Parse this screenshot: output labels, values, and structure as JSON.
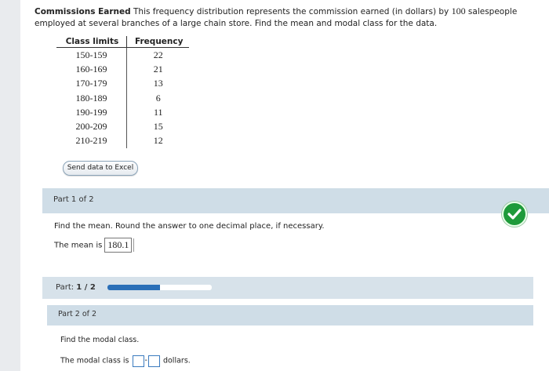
{
  "problem": {
    "title": "Commissions Earned",
    "text1": " This frequency distribution represents the commission earned (in dollars) by ",
    "count": "100",
    "text2": " salespeople employed at several branches of a large chain store. Find the mean and modal class for the data."
  },
  "table": {
    "headers": [
      "Class limits",
      "Frequency"
    ],
    "rows": [
      {
        "limits": "150-159",
        "freq": "22"
      },
      {
        "limits": "160-169",
        "freq": "21"
      },
      {
        "limits": "170-179",
        "freq": "13"
      },
      {
        "limits": "180-189",
        "freq": "6"
      },
      {
        "limits": "190-199",
        "freq": "11"
      },
      {
        "limits": "200-209",
        "freq": "15"
      },
      {
        "limits": "210-219",
        "freq": "12"
      }
    ]
  },
  "excel_button": "Send data to Excel",
  "part1": {
    "header": "Part 1 of 2",
    "instruction": "Find the mean. Round the answer to one decimal place, if necessary.",
    "answer_prefix": "The mean is",
    "answer_value": "180.1",
    "status_icon": "check-icon",
    "status_color": "#1e9a3a"
  },
  "progress": {
    "label_prefix": "Part: ",
    "label_value": "1 / 2",
    "fraction": 0.5,
    "color": "#2a6fb7"
  },
  "part2": {
    "header": "Part 2 of 2",
    "instruction": "Find the modal class.",
    "answer_prefix": "The modal class is",
    "separator": "-",
    "answer_suffix": "dollars."
  }
}
